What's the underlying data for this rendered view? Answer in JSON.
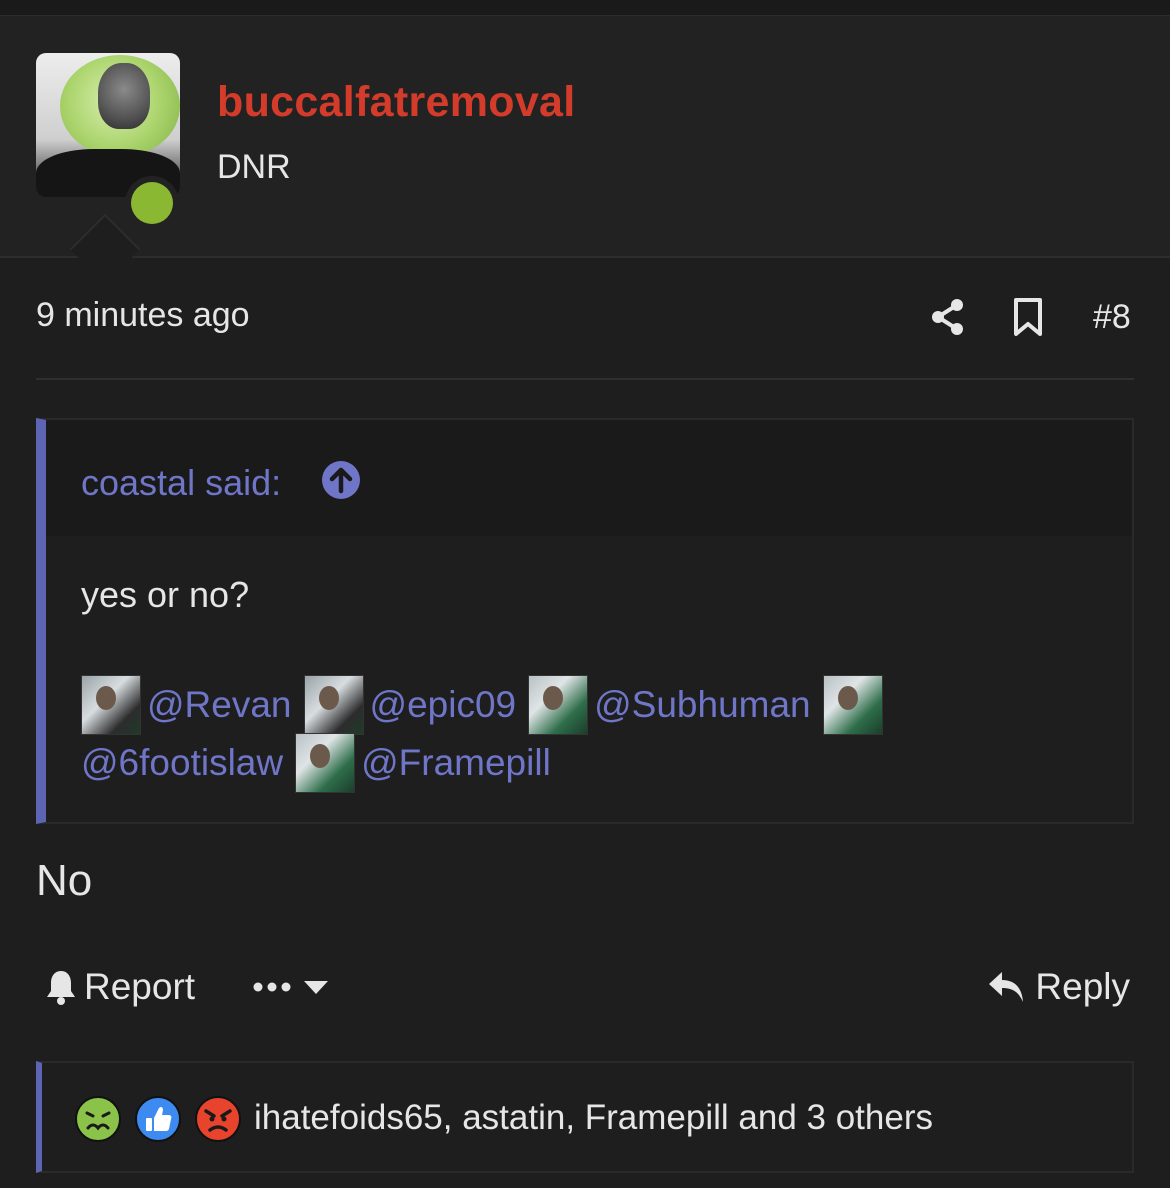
{
  "user": {
    "username": "buccalfatremoval",
    "title": "DNR",
    "status_color": "#8ab832",
    "name_color": "#d33b2a"
  },
  "post": {
    "time": "9 minutes ago",
    "number": "#8",
    "body": "No"
  },
  "quote": {
    "attribution": "coastal said:",
    "text": "yes or no?",
    "mentions_line1": [
      "@Revan",
      "@epic09",
      "@Subhuman"
    ],
    "mentions_line2": [
      "@6footislaw",
      "@Framepill"
    ]
  },
  "actions": {
    "report_label": "Report",
    "reply_label": "Reply"
  },
  "reactions": {
    "icons": [
      "sick-reaction-icon",
      "like-reaction-icon",
      "angry-reaction-icon"
    ],
    "summary": "ihatefoids65, astatin, Framepill and 3 others"
  },
  "accent": "#5d64b3",
  "link_color": "#6f76c8"
}
